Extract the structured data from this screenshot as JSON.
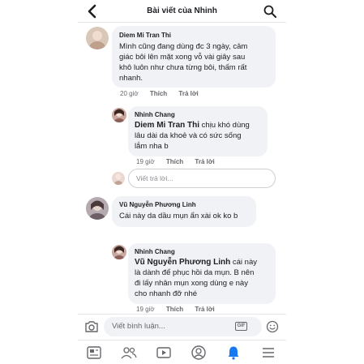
{
  "header": {
    "title": "Bài viết của Nhinh"
  },
  "comments": [
    {
      "name": "Diem Mi Tran Thi",
      "text": [
        "Mình cũng đang dùng đc 3 ngày, cảm",
        "giác bôi lên mặt xong vỗ vài giây sau",
        "khô luôn như chưa từng bôi, thấm rất",
        "nhanh."
      ],
      "time": "20 giờ",
      "like": "Thích",
      "reply": "Trả lời"
    },
    {
      "name": "Nhinh Chang",
      "mention": "Diem Mi Tran Thi",
      "text": [
        " chịu khó dùng",
        "lâu dài da khoẻ và có sức sống",
        "lắm nha b"
      ],
      "time": "19 giờ",
      "like": "Thích",
      "reply": "Trả lời"
    },
    {
      "name": "Vũ Nguyễn Phương Linh",
      "text": [
        "Cái này da dầu mụn ẩn xài ok ko b"
      ]
    },
    {
      "name": "Nhinh Chang",
      "mention": "Vũ Nguyễn Phương Linh",
      "text": [
        " cái này",
        "là dành để phục hồi da mụn. B nên",
        "đi lấy nhân mụn xong dùng e này",
        "cho nhanh đỡ nhé"
      ],
      "time": "19 giờ",
      "like": "Thích",
      "reply": "Trả lời"
    }
  ],
  "reply_placeholder": "Viết trả lời...",
  "composer": {
    "placeholder": "Viết bình luận...",
    "gif": "GIF"
  },
  "icons": [
    "back-icon",
    "search-icon",
    "camera-icon",
    "gif-icon",
    "emoji-icon",
    "feed-icon",
    "friends-icon",
    "video-icon",
    "profile-icon",
    "bell-icon",
    "menu-icon"
  ],
  "colors": {
    "accent": "#1877f2",
    "bubble": "#f0f2f5",
    "muted": "#65676b"
  }
}
